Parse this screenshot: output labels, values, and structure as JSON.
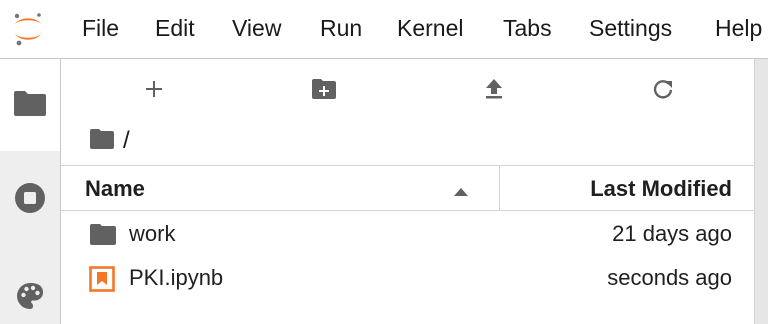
{
  "menubar": {
    "logo_icon": "jupyter-logo",
    "items": [
      "File",
      "Edit",
      "View",
      "Run",
      "Kernel",
      "Tabs",
      "Settings",
      "Help"
    ]
  },
  "sidebar": {
    "tabs": [
      {
        "icon": "folder-icon",
        "active": true
      },
      {
        "icon": "stop-circle-icon",
        "active": false
      },
      {
        "icon": "palette-icon",
        "active": false
      }
    ]
  },
  "toolbar": {
    "buttons": [
      "new-launcher-icon",
      "new-folder-icon",
      "upload-icon",
      "refresh-icon"
    ]
  },
  "breadcrumb": {
    "icon": "folder-icon",
    "separator": "/"
  },
  "file_list": {
    "columns": {
      "name": "Name",
      "modified": "Last Modified"
    },
    "sort": "name-ascending",
    "rows": [
      {
        "name": "work",
        "modified": "21 days ago",
        "type": "folder"
      },
      {
        "name": "PKI.ipynb",
        "modified": "seconds ago",
        "type": "notebook"
      }
    ]
  },
  "colors": {
    "accent": "#F37726",
    "icon": "#616161",
    "border": "#d4d4d4"
  }
}
